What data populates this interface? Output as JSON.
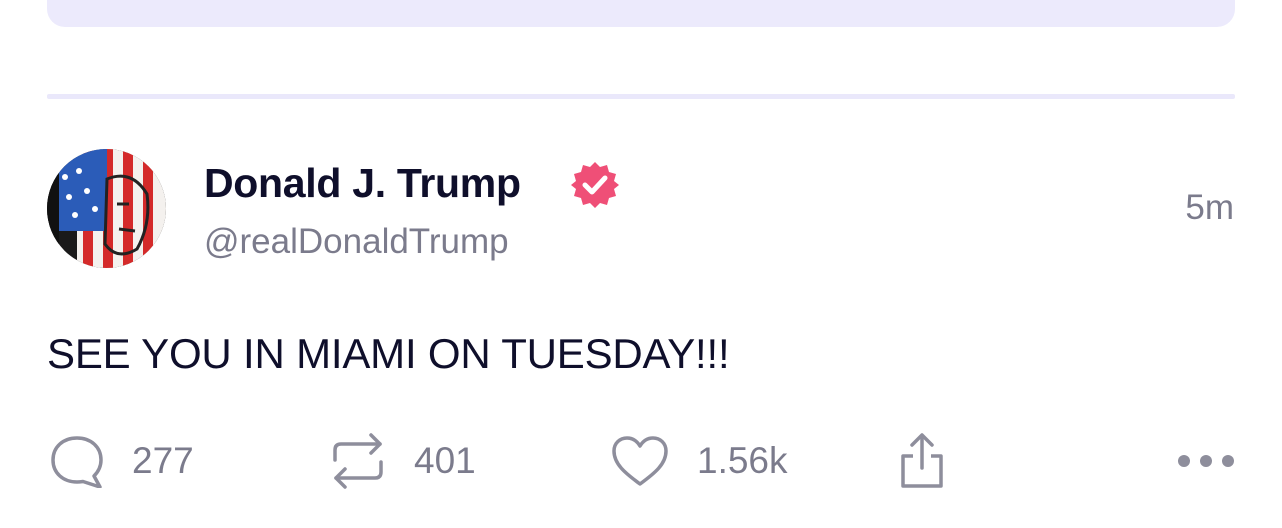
{
  "post": {
    "author": {
      "display_name": "Donald J. Trump",
      "handle": "@realDonaldTrump",
      "verified": true,
      "avatar_icon": "flag-portrait-avatar"
    },
    "timestamp": "5m",
    "text": "SEE YOU IN MIAMI ON TUESDAY!!!",
    "actions": {
      "replies": "277",
      "reposts": "401",
      "likes": "1.56k"
    }
  },
  "colors": {
    "verified_badge": "#ef4f77",
    "muted_text": "#7b7b8c",
    "primary_text": "#0f0f2b",
    "divider": "#eae8fb",
    "top_card": "#eceafc"
  },
  "icons": {
    "reply": "speech-bubble-icon",
    "repost": "repost-arrows-icon",
    "like": "heart-icon",
    "share": "share-upload-icon",
    "more": "more-dots-icon",
    "verified": "verified-badge-icon"
  }
}
